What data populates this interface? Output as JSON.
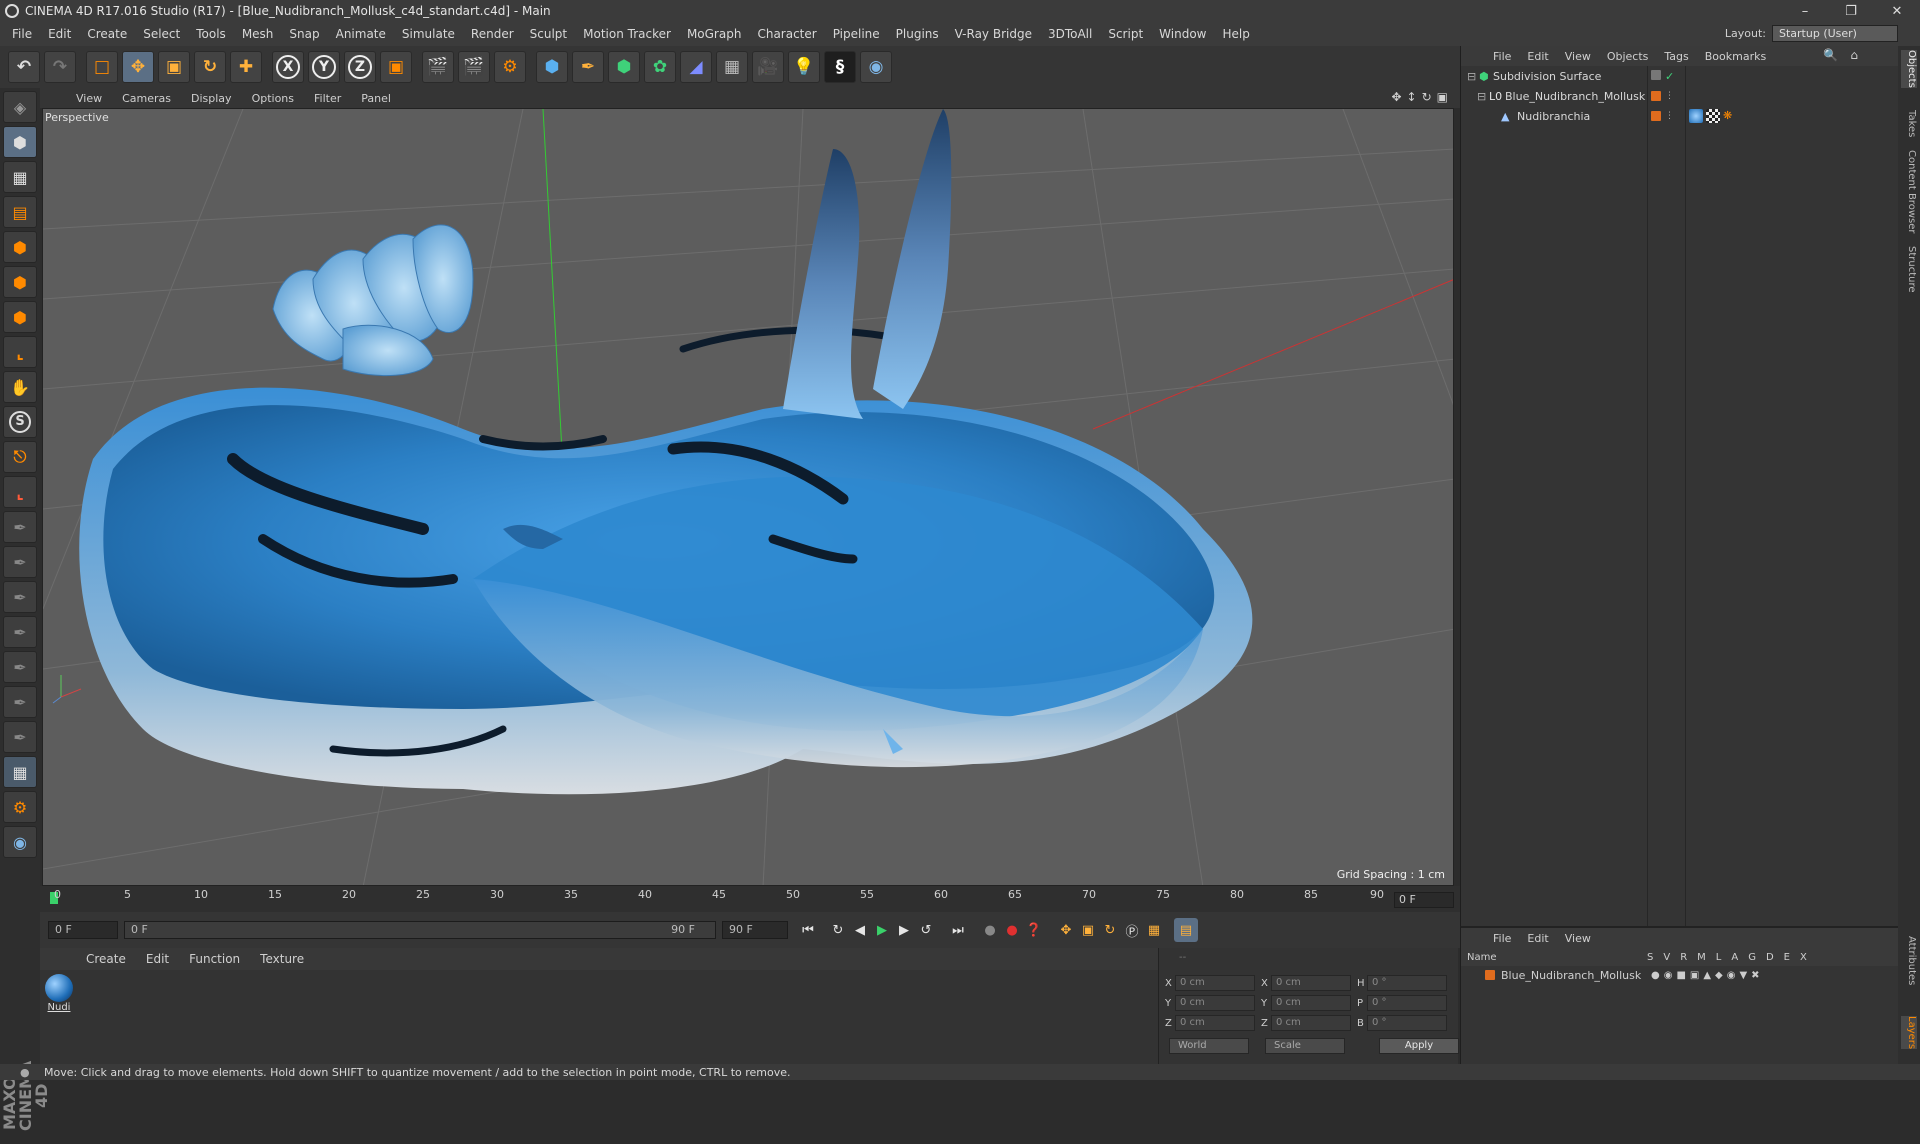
{
  "window": {
    "title": "CINEMA 4D R17.016 Studio (R17) - [Blue_Nudibranch_Mollusk_c4d_standart.c4d] - Main",
    "minimize_icon": "minimize-icon",
    "maximize_icon": "restore-icon",
    "close_icon": "close-icon"
  },
  "menu": {
    "items": [
      "File",
      "Edit",
      "Create",
      "Select",
      "Tools",
      "Mesh",
      "Snap",
      "Animate",
      "Simulate",
      "Render",
      "Sculpt",
      "Motion Tracker",
      "MoGraph",
      "Character",
      "Pipeline",
      "Plugins",
      "V-Ray Bridge",
      "3DToAll",
      "Script",
      "Window",
      "Help"
    ],
    "layout_label": "Layout:",
    "layout_value": "Startup (User)"
  },
  "toolbar": {
    "x_label": "X",
    "y_label": "Y",
    "z_label": "Z"
  },
  "left_tools": {
    "s_label": "S"
  },
  "viewport": {
    "menu": [
      "View",
      "Cameras",
      "Display",
      "Options",
      "Filter",
      "Panel"
    ],
    "label": "Perspective",
    "grid_spacing": "Grid Spacing : 1 cm"
  },
  "timeline": {
    "ticks": [
      "0",
      "5",
      "10",
      "15",
      "20",
      "25",
      "30",
      "35",
      "40",
      "45",
      "50",
      "55",
      "60",
      "65",
      "70",
      "75",
      "80",
      "85",
      "90"
    ],
    "current_frame": "0 F"
  },
  "transport": {
    "start_frame": "0 F",
    "range_start": "0 F",
    "range_end": "90 F",
    "end_frame": "90 F"
  },
  "materials": {
    "menu": [
      "Create",
      "Edit",
      "Function",
      "Texture"
    ],
    "item_name": "Nudi"
  },
  "coordinates": {
    "rows": [
      {
        "a": "X",
        "v1": "0 cm",
        "b": "X",
        "v2": "0 cm",
        "c": "H",
        "v3": "0 °"
      },
      {
        "a": "Y",
        "v1": "0 cm",
        "b": "Y",
        "v2": "0 cm",
        "c": "P",
        "v3": "0 °"
      },
      {
        "a": "Z",
        "v1": "0 cm",
        "b": "Z",
        "v2": "0 cm",
        "c": "B",
        "v3": "0 °"
      }
    ],
    "mode1": "World",
    "mode2": "Scale",
    "apply": "Apply",
    "header_dashes": "--"
  },
  "status": "Move: Click and drag to move elements. Hold down SHIFT to quantize movement / add to the selection in point mode, CTRL to remove.",
  "object_manager": {
    "menu": [
      "File",
      "Edit",
      "View",
      "Objects",
      "Tags",
      "Bookmarks"
    ],
    "objects": [
      {
        "name": "Subdivision Surface"
      },
      {
        "name": "Blue_Nudibranch_Mollusk"
      },
      {
        "name": "Nudibranchia"
      }
    ]
  },
  "attributes": {
    "menu": [
      "File",
      "Edit",
      "View"
    ],
    "col_name": "Name",
    "cols": [
      "S",
      "V",
      "R",
      "M",
      "L",
      "A",
      "G",
      "D",
      "E",
      "X"
    ],
    "row_name": "Blue_Nudibranch_Mollusk"
  },
  "right_tabs": [
    "Objects",
    "Takes",
    "Content Browser",
    "Structure",
    "Attributes",
    "Layers"
  ],
  "brand": "MAXON CINEMA 4D",
  "colors": {
    "accent_orange": "#ff8a00",
    "object_orange": "#e06c1e",
    "mollusk_blue": "#2f86cc"
  }
}
